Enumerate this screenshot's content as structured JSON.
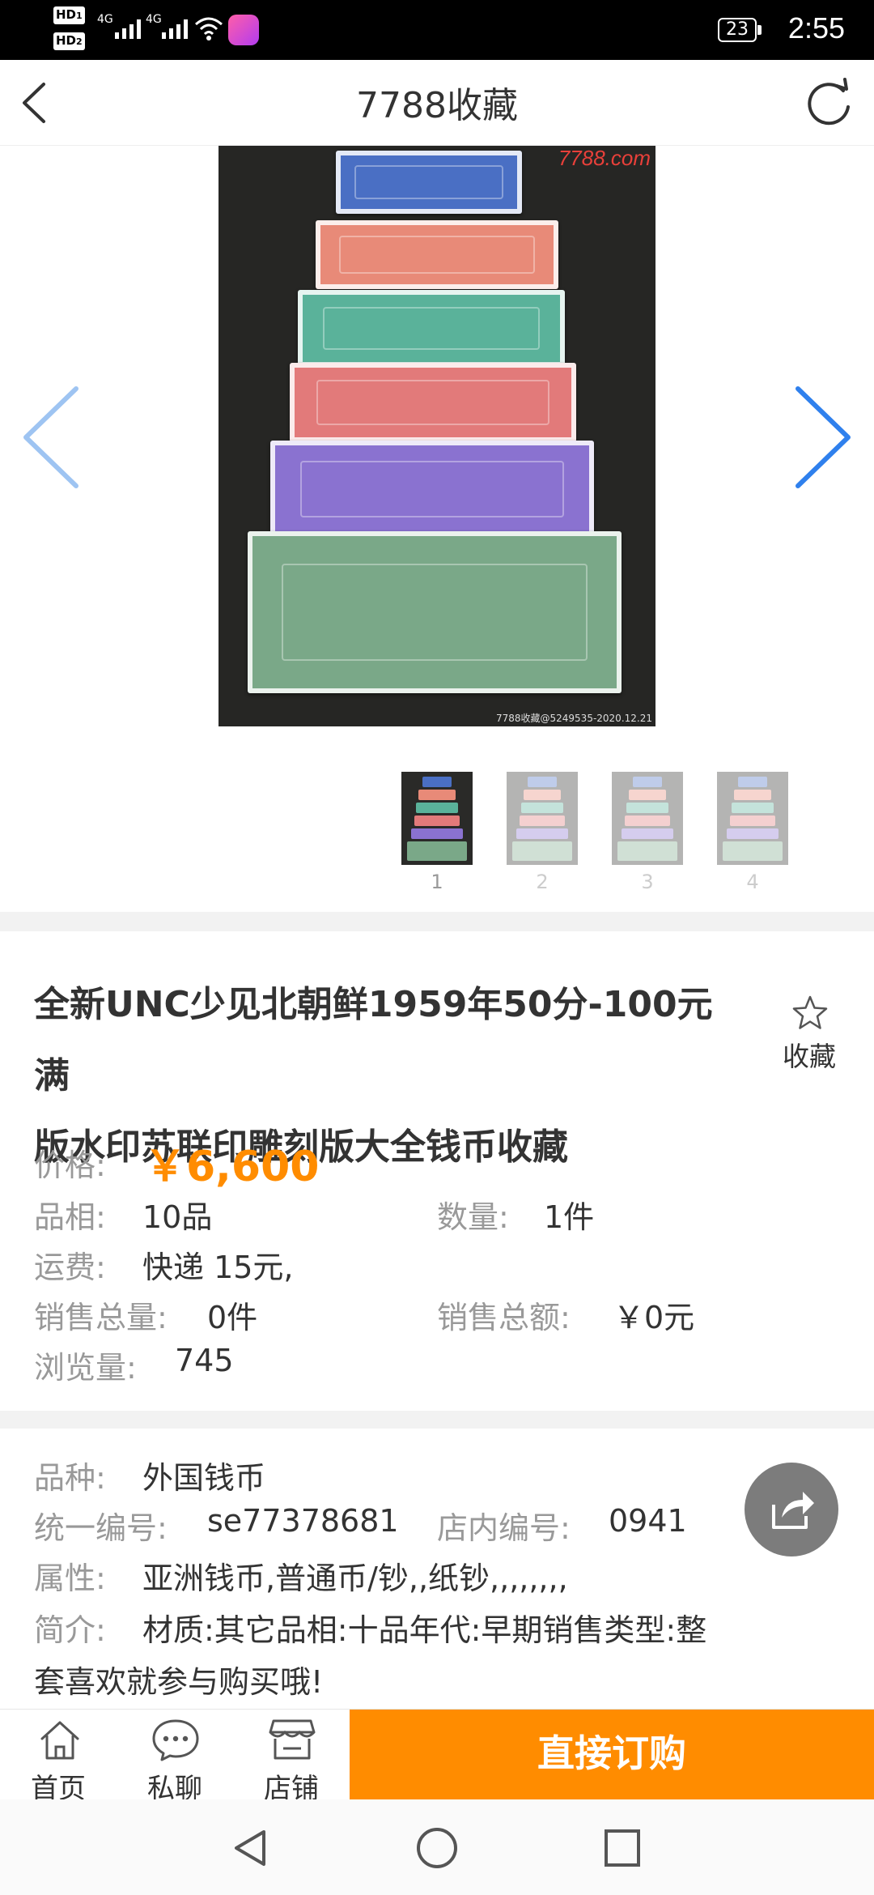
{
  "status_bar": {
    "hd1": "HD",
    "hd1_sub": "1",
    "hd2": "HD",
    "hd2_sub": "2",
    "net1": "4G",
    "net2": "4G",
    "battery": "23",
    "time": "2:55"
  },
  "header": {
    "title": "7788收藏",
    "back_icon": "chevron-left-icon",
    "refresh_icon": "refresh-icon"
  },
  "gallery": {
    "watermark": "7788.com",
    "caption": "7788收藏@5249535-2020.12.21",
    "prev_icon": "chevron-left-icon",
    "next_icon": "chevron-right-icon",
    "thumbnails": [
      {
        "index": "1",
        "selected": true
      },
      {
        "index": "2",
        "selected": false
      },
      {
        "index": "3",
        "selected": false
      },
      {
        "index": "4",
        "selected": false
      }
    ]
  },
  "product": {
    "title_line1": "全新UNC少见北朝鲜1959年50分-100元满",
    "title_line2": "版水印苏联印雕刻版大全钱币收藏",
    "favorite_label": "收藏",
    "price_label": "价格:",
    "price": "￥6,600",
    "condition_label": "品相:",
    "condition": "10品",
    "quantity_label": "数量:",
    "quantity": "1件",
    "shipping_label": "运费:",
    "shipping": "快递 15元,",
    "sales_count_label": "销售总量:",
    "sales_count": "0件",
    "sales_amount_label": "销售总额:",
    "sales_amount": "￥0元",
    "views_label": "浏览量:",
    "views": "745"
  },
  "details": {
    "category_label": "品种:",
    "category": "外国钱币",
    "serial_label": "统一编号:",
    "serial": "se77378681",
    "store_code_label": "店内编号:",
    "store_code": "0941",
    "attributes_label": "属性:",
    "attributes": "亚洲钱币,普通币/钞,,纸钞,,,,,,,,",
    "intro_label": "简介:",
    "intro_line1": "材质:其它品相:十品年代:早期销售类型:整",
    "intro_line2": "套喜欢就参与购买哦!"
  },
  "bottom_bar": {
    "home": "首页",
    "chat": "私聊",
    "shop": "店铺",
    "buy": "直接订购"
  },
  "colors": {
    "accent": "#ff8c00",
    "arrow_blue": "#2f80ed",
    "arrow_light": "#9ec4f2"
  }
}
